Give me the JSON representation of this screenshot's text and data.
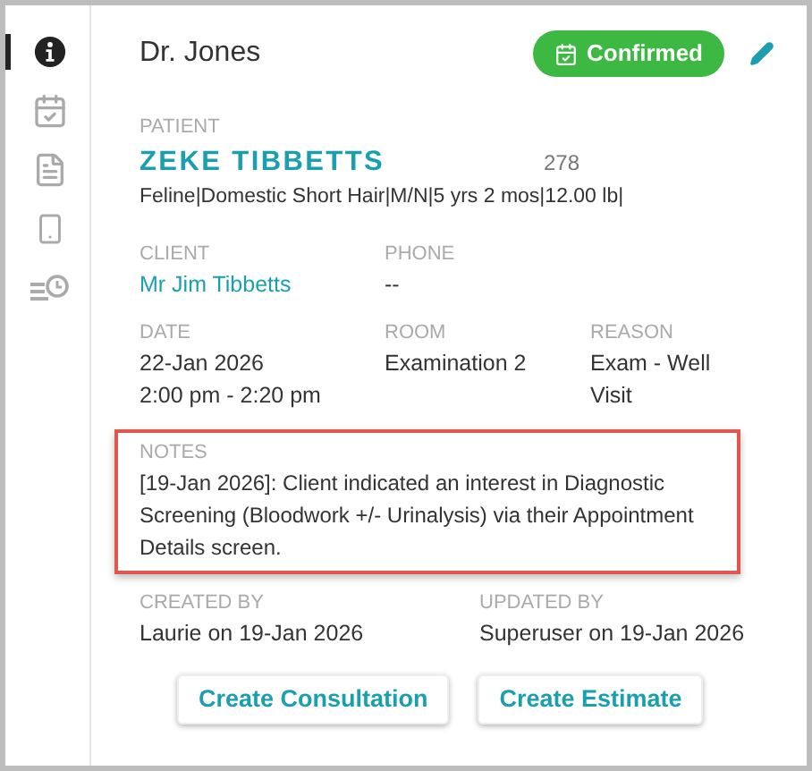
{
  "sidebar": {
    "items": [
      {
        "kind": "info",
        "selected": true
      },
      {
        "kind": "calendar",
        "selected": false
      },
      {
        "kind": "document",
        "selected": false
      },
      {
        "kind": "phone",
        "selected": false
      },
      {
        "kind": "history",
        "selected": false
      }
    ]
  },
  "header": {
    "title": "Dr. Jones",
    "status": "Confirmed"
  },
  "patient": {
    "label": "PATIENT",
    "name": "ZEKE TIBBETTS",
    "id": "278",
    "details": "Feline|Domestic Short Hair|M/N|5 yrs 2 mos|12.00 lb|"
  },
  "client": {
    "label": "CLIENT",
    "value": "Mr Jim Tibbetts"
  },
  "phone": {
    "label": "PHONE",
    "value": "--"
  },
  "date": {
    "label": "DATE",
    "lines": [
      "22-Jan 2026",
      "2:00 pm - 2:20 pm"
    ]
  },
  "room": {
    "label": "ROOM",
    "value": "Examination 2"
  },
  "reason": {
    "label": "REASON",
    "value": "Exam - Well Visit"
  },
  "notes": {
    "label": "NOTES",
    "text": "[19-Jan 2026]: Client indicated an interest in Diagnostic Screening (Bloodwork +/- Urinalysis) via their Appointment Details screen.",
    "highlighted": true
  },
  "created": {
    "label": "CREATED BY",
    "value": "Laurie on 19-Jan 2026"
  },
  "updated": {
    "label": "UPDATED BY",
    "value": "Superuser on 19-Jan 2026"
  },
  "buttons": [
    "Create Consultation",
    "Create Estimate"
  ]
}
